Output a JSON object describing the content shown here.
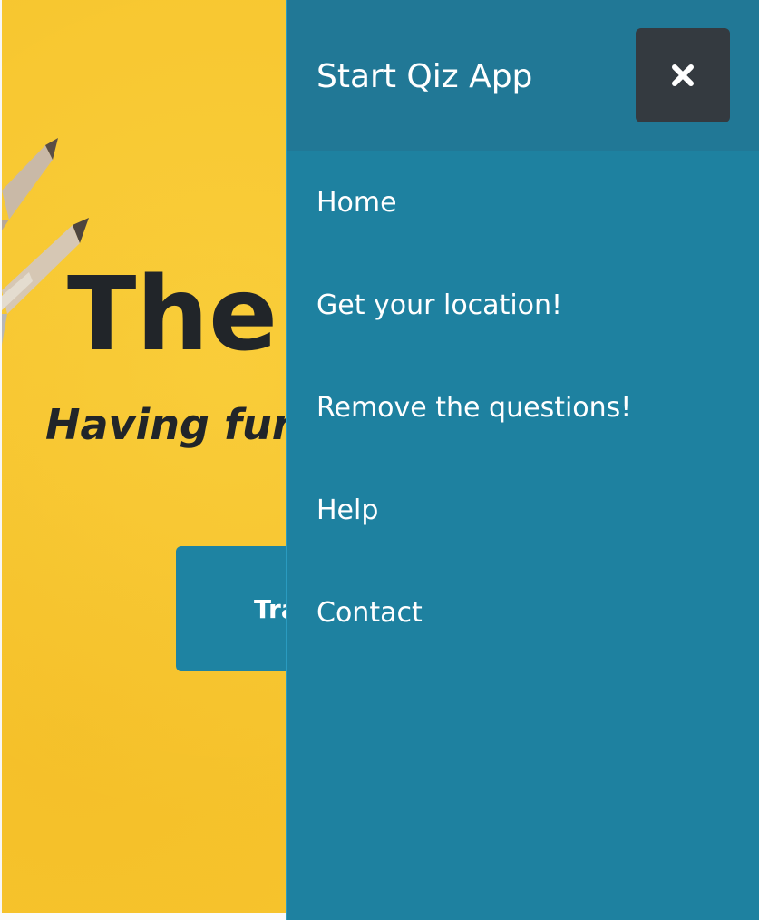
{
  "hero": {
    "title": "The",
    "subtitle": "Having fun",
    "button_label": "Tra"
  },
  "drawer": {
    "title": "Start Qiz App",
    "close_icon": "close-icon",
    "items": [
      {
        "label": "Home"
      },
      {
        "label": "Get your location!"
      },
      {
        "label": "Remove the questions!"
      },
      {
        "label": "Help"
      },
      {
        "label": "Contact"
      }
    ]
  },
  "colors": {
    "hero_background": "#f7c62f",
    "drawer_background": "#1e81a0",
    "drawer_header_background": "#217896",
    "close_button_background": "#343a40",
    "text_dark": "#212529",
    "text_light": "#ffffff"
  }
}
